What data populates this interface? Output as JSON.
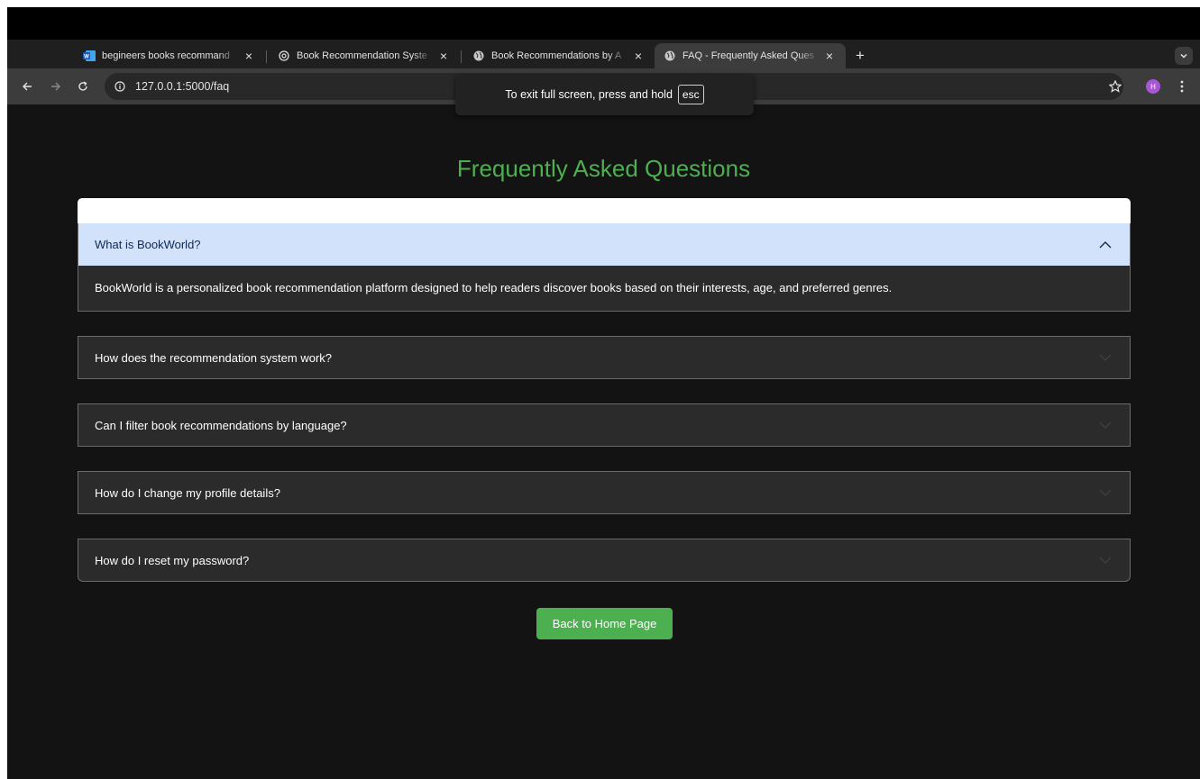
{
  "browser": {
    "tabs": [
      {
        "title": "begineers books recommand",
        "icon": "word-doc-icon",
        "active": false
      },
      {
        "title": "Book Recommendation Syste",
        "icon": "openai-icon",
        "active": false
      },
      {
        "title": "Book Recommendations by A",
        "icon": "globe-icon",
        "active": false
      },
      {
        "title": "FAQ - Frequently Asked Ques",
        "icon": "globe-icon",
        "active": true
      }
    ],
    "new_tab": "+",
    "url": "127.0.0.1:5000/faq",
    "profile_initial": "H",
    "fullscreen_notice": {
      "text": "To exit full screen, press and hold",
      "key": "esc"
    }
  },
  "page": {
    "title": "Frequently Asked Questions",
    "faqs": [
      {
        "question": "What is BookWorld?",
        "answer": "BookWorld is a personalized book recommendation platform designed to help readers discover books based on their interests, age, and preferred genres.",
        "expanded": true
      },
      {
        "question": "How does the recommendation system work?",
        "expanded": false
      },
      {
        "question": "Can I filter book recommendations by language?",
        "expanded": false
      },
      {
        "question": "How do I change my profile details?",
        "expanded": false
      },
      {
        "question": "How do I reset my password?",
        "expanded": false
      }
    ],
    "back_button": "Back to Home Page"
  },
  "colors": {
    "accent_green": "#4caf50",
    "page_bg": "#131313",
    "panel_bg": "#2b2b2b",
    "expanded_header_bg": "#d3e2fb"
  }
}
